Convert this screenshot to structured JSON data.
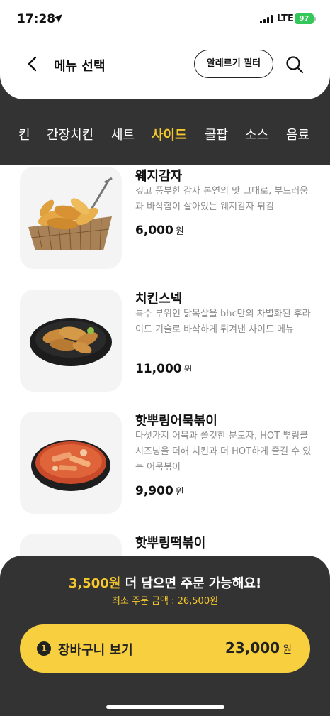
{
  "status_bar": {
    "time": "17:28",
    "network": "LTE",
    "battery": "97"
  },
  "header": {
    "title": "메뉴 선택",
    "allergy_filter_label": "알레르기 필터"
  },
  "tabs": [
    {
      "label": "킨",
      "active": false
    },
    {
      "label": "간장치킨",
      "active": false
    },
    {
      "label": "세트",
      "active": false
    },
    {
      "label": "사이드",
      "active": true
    },
    {
      "label": "콜팝",
      "active": false
    },
    {
      "label": "소스",
      "active": false
    },
    {
      "label": "음료",
      "active": false
    }
  ],
  "menu_items": [
    {
      "name": "웨지감자",
      "description": "깊고 풍부한 감자 본연의 맛 그대로, 부드러움과 바삭함이 살아있는 웨지감자 튀김",
      "price": "6,000",
      "currency": "원",
      "image": "wedge-potato-basket"
    },
    {
      "name": "치킨스넥",
      "description": "특수 부위인 닭목살을 bhc만의 차별화된 후라이드 기술로 바삭하게 튀겨낸 사이드 메뉴",
      "price": "11,000",
      "currency": "원",
      "image": "fried-chicken-neck-plate"
    },
    {
      "name": "핫뿌링어묵볶이",
      "description": "다섯가지 어묵과 쫄깃한 분모자, HOT 뿌링클 시즈닝을 더해 치킨과 더 HOT하게 즐길 수 있는 어묵볶이",
      "price": "9,900",
      "currency": "원",
      "image": "fishcake-tteokbokki-bowl"
    },
    {
      "name": "핫뿌링떡볶이",
      "description": "",
      "price": "",
      "currency": "",
      "image": ""
    }
  ],
  "cart": {
    "notice_highlight": "3,500원",
    "notice_text": " 더 담으면 주문 가능해요!",
    "min_order": "최소 주문 금액 : 26,500원",
    "count": "1",
    "button_label": "장바구니 보기",
    "total": "23,000",
    "currency": "원"
  },
  "colors": {
    "accent": "#f5c72e",
    "dark": "#333333",
    "cart_button": "#f7cf3f"
  }
}
